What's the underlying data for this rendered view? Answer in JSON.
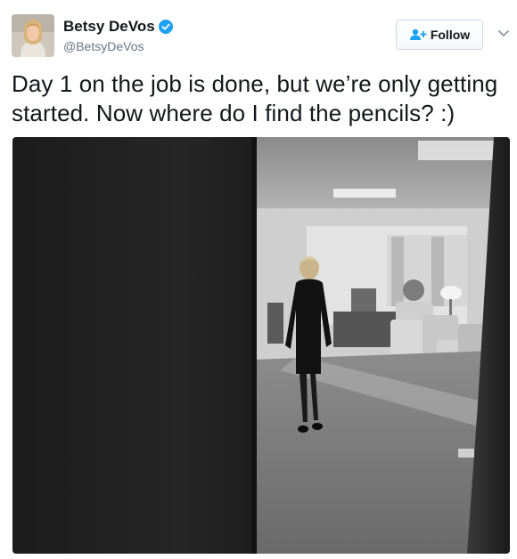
{
  "user": {
    "display_name": "Betsy DeVos",
    "handle": "@BetsyDeVos",
    "verified_icon": "verified-badge-icon",
    "avatar_icon": "profile-avatar"
  },
  "follow_button": {
    "label": "Follow",
    "icon": "add-person-icon"
  },
  "tweet": {
    "text": "Day 1 on the job is done, but we’re only getting started. Now where do I find the pencils? :)"
  },
  "media": {
    "type": "photo",
    "style": "black-and-white"
  },
  "colors": {
    "accent": "#1da1f2",
    "handle_gray": "#657786",
    "text": "#14171a"
  }
}
